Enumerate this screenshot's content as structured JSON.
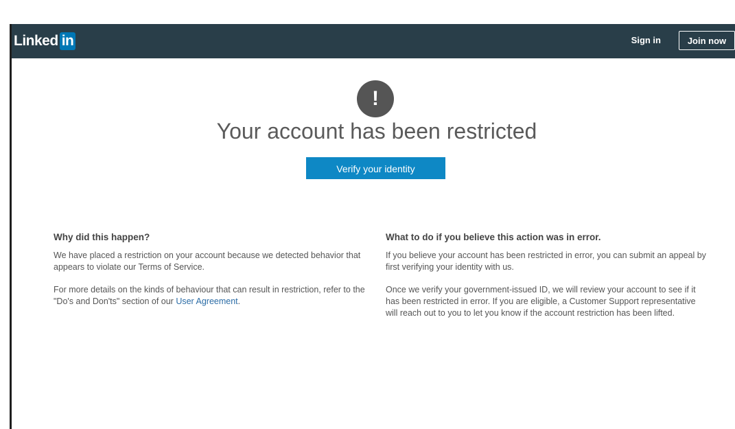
{
  "navbar": {
    "logo_text": "Linked",
    "logo_in": "in",
    "signin_label": "Sign in",
    "join_label": "Join now",
    "background_color": "#293e49",
    "logo_badge_color": "#0077b5"
  },
  "alert": {
    "icon_name": "exclamation-circle-icon",
    "icon_glyph": "!"
  },
  "main": {
    "title": "Your account has been restricted",
    "verify_button_label": "Verify your identity",
    "verify_button_color": "#0e88c5"
  },
  "left_section": {
    "heading": "Why did this happen?",
    "paragraph1": "We have placed a restriction on your account because we detected behavior that appears to violate our Terms of Service.",
    "paragraph2_prefix": "For more details on the kinds of behaviour that can result in restriction, refer to the \"Do's and Don'ts\" section of our ",
    "paragraph2_link": "User Agreement",
    "paragraph2_suffix": "."
  },
  "right_section": {
    "heading": "What to do if you believe this action was in error.",
    "paragraph1": "If you believe your account has been restricted in error, you can submit an appeal by first verifying your identity with us.",
    "paragraph2": "Once we verify your government-issued ID, we will review your account to see if it has been restricted in error. If you are eligible, a Customer Support representative will reach out to you to let you know if the account restriction has been lifted."
  }
}
